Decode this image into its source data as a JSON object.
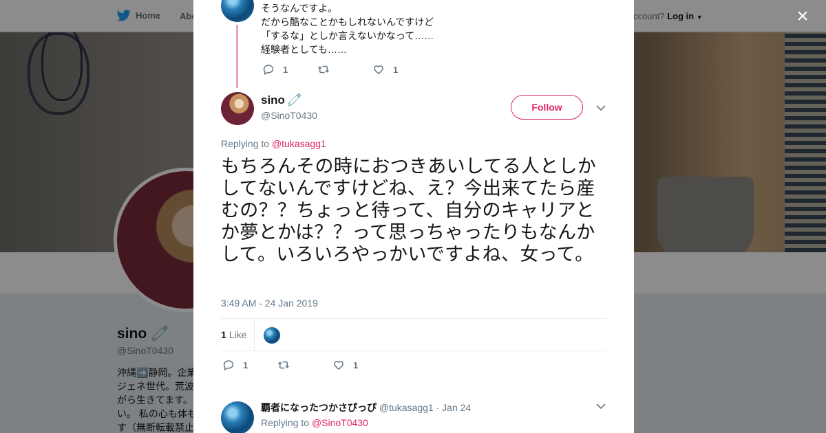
{
  "background": {
    "nav": {
      "home": "Home",
      "about": "Abo",
      "account_prompt": "ccount?",
      "login": "Log in"
    },
    "profile": {
      "name": "sino",
      "handle": "@SinoT0430",
      "bio": "沖縄➡️静岡。企業\nジェネ世代。荒波\nがら生きてます。\nい。 私の心も体も\nす（無断転載禁止"
    }
  },
  "modal": {
    "close_label": "×",
    "previous_tweet": {
      "lines": [
        "そうなんですよ。",
        "だから酷なことかもしれないんですけど",
        "「するな」としか言えないかなって……",
        "経験者としても……"
      ],
      "reply_count": "1",
      "retweet_count": "",
      "like_count": "1"
    },
    "main_tweet": {
      "name": "sino",
      "handle": "@SinoT0430",
      "follow_label": "Follow",
      "replying_prefix": "Replying to",
      "replying_to": "@tukasagg1",
      "text": "もちろんその時におつきあいしてる人としかしてないんですけどね、え？今出来てたら産むの？？ちょっと待って、自分のキャリアとか夢とかは？？って思っちゃったりもなんかして。いろいろやっかいですよね、女って。",
      "timestamp": "3:49 AM - 24 Jan 2019",
      "like_stat_count": "1",
      "like_stat_label": "Like",
      "reply_count": "1",
      "retweet_count": "",
      "like_count": "1"
    },
    "reply_tweet": {
      "name": "覇者になったつかさぴっぴ",
      "handle": "@tukasagg1",
      "date": "· Jan 24",
      "replying_prefix": "Replying to",
      "replying_to": "@SinoT0430"
    }
  },
  "colors": {
    "accent": "#e0245e",
    "twitter_blue": "#1da1f2",
    "thread_line": "#f0a0b8",
    "muted_text": "#657786"
  }
}
